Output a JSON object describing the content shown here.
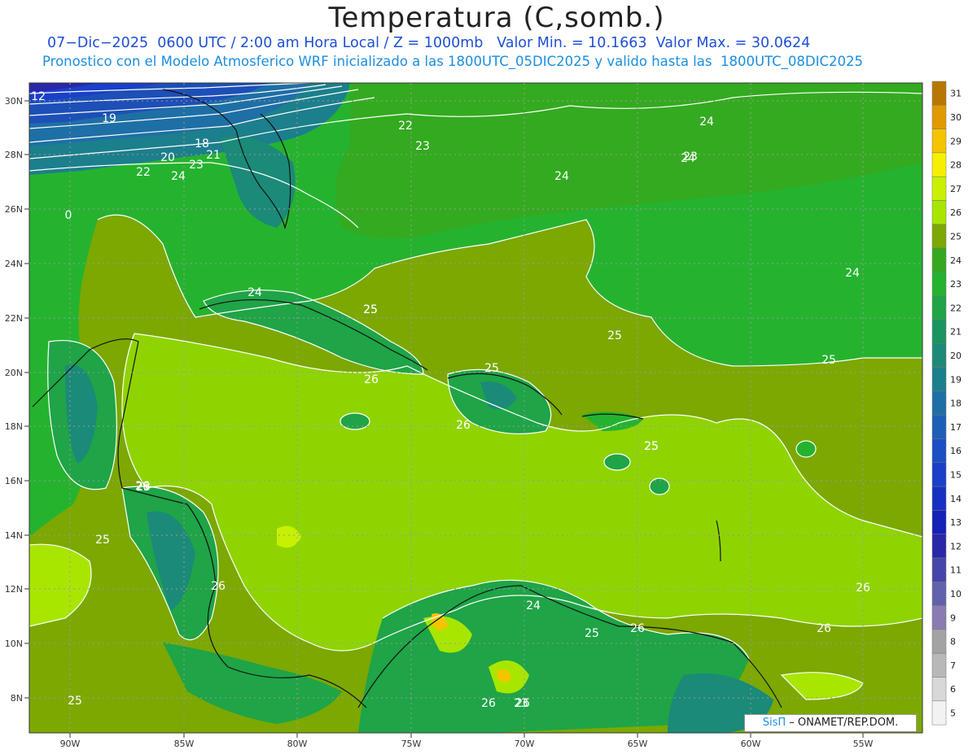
{
  "header": {
    "title": "Temperatura (C,somb.)",
    "line1": "07−Dic−2025  0600 UTC / 2:00 am Hora Local / Z = 1000mb   Valor Min. = 10.1663  Valor Max. = 30.0624",
    "line2": "Pronostico con el Modelo Atmosferico WRF inicializado a las 1800UTC_05DIC2025 y valido hasta las  1800UTC_08DIC2025"
  },
  "axes": {
    "lat_labels": [
      "30N",
      "28N",
      "26N",
      "24N",
      "22N",
      "20N",
      "18N",
      "16N",
      "14N",
      "12N",
      "10N",
      "8N"
    ],
    "lon_labels": [
      "90W",
      "85W",
      "80W",
      "75W",
      "70W",
      "65W",
      "60W",
      "55W"
    ]
  },
  "colorbar": {
    "levels": [
      31,
      30,
      29,
      28,
      27,
      26,
      25,
      24,
      23,
      22,
      21,
      20,
      19,
      18,
      17,
      16,
      15,
      14,
      13,
      12,
      11,
      10,
      9,
      8,
      7,
      6,
      5
    ],
    "colors": [
      "#b87800",
      "#e09a00",
      "#f5c400",
      "#f5f000",
      "#c8f000",
      "#a8e600",
      "#7ca800",
      "#36a81f",
      "#25b32f",
      "#1fa447",
      "#1a9460",
      "#1b8a78",
      "#1c7f8c",
      "#1e6fa6",
      "#1d5fb7",
      "#1c4fc4",
      "#1a3fc9",
      "#1730c3",
      "#1422b8",
      "#2828a8",
      "#4646a8",
      "#6262ac",
      "#8a7cb2",
      "#a3a3a3",
      "#b8b8b8",
      "#d8d8d8",
      "#f2f2f2"
    ]
  },
  "contour_labels": [
    "12",
    "19",
    "18",
    "21",
    "20",
    "22",
    "24",
    "23",
    "22",
    "23",
    "24",
    "23",
    "24",
    "0",
    "24",
    "24",
    "25",
    "25",
    "25",
    "25",
    "26",
    "25",
    "26",
    "26",
    "26",
    "25",
    "25",
    "26",
    "26",
    "26",
    "24",
    "25",
    "26",
    "26",
    "23",
    "25",
    "23",
    "24",
    "25"
  ],
  "credit": {
    "brand": "SisΠ",
    "text": " – ONAMET/REP.DOM."
  }
}
